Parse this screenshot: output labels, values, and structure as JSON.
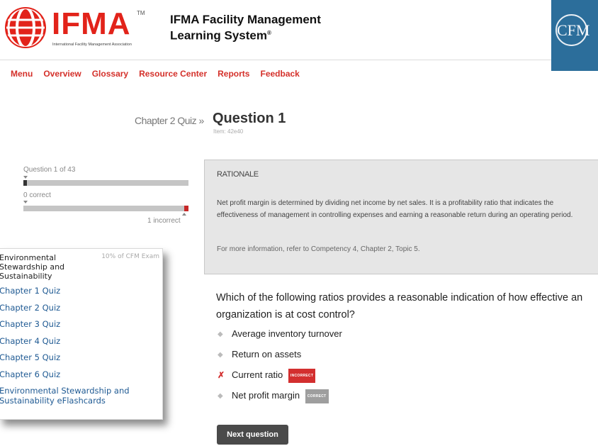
{
  "brand": {
    "logo_text": "IFMA",
    "logo_tm": "TM",
    "logo_subtitle": "International Facility Management Association",
    "title_line1": "IFMA Facility Management",
    "title_line2": "Learning System",
    "title_reg": "®",
    "cfm_logo": "CFM",
    "colors": {
      "red": "#e2231a",
      "cfm_blue": "#2c6e9b"
    }
  },
  "nav": {
    "items": [
      {
        "label": "Menu"
      },
      {
        "label": "Overview"
      },
      {
        "label": "Glossary"
      },
      {
        "label": "Resource Center"
      },
      {
        "label": "Reports"
      },
      {
        "label": "Feedback"
      }
    ]
  },
  "page": {
    "breadcrumb": "Chapter 2 Quiz »",
    "title": "Question 1",
    "item_id": "Item: 42e40"
  },
  "progress": {
    "question_label": "Question 1 of 43",
    "question_fraction": 0.023,
    "correct_label": "0 correct",
    "incorrect_label": "1 incorrect"
  },
  "popup": {
    "topic": "Environmental Stewardship and Sustainability",
    "percent": "10% of CFM Exam",
    "items": [
      {
        "label": "Chapter 1 Quiz"
      },
      {
        "label": "Chapter 2 Quiz"
      },
      {
        "label": "Chapter 3 Quiz"
      },
      {
        "label": "Chapter 4 Quiz"
      },
      {
        "label": "Chapter 5 Quiz"
      },
      {
        "label": "Chapter 6 Quiz"
      },
      {
        "label": "Environmental Stewardship and Sustainability eFlashcards"
      }
    ]
  },
  "rationale": {
    "heading": "RATIONALE",
    "body": "Net profit margin is determined by dividing net income by net sales. It is a profitability ratio that indicates the effectiveness of management in controlling expenses and earning a reasonable return during an operating period.",
    "reference": "For more information, refer to Competency 4, Chapter 2, Topic 5."
  },
  "question": {
    "text": "Which of the following ratios provides a reasonable indication of how effective an organization is at cost control?",
    "answers": [
      {
        "label": "Average inventory turnover",
        "mark": "◆",
        "badge": ""
      },
      {
        "label": "Return on assets",
        "mark": "◆",
        "badge": ""
      },
      {
        "label": "Current ratio",
        "mark": "✗",
        "badge": "INCORRECT"
      },
      {
        "label": "Net profit margin",
        "mark": "◆",
        "badge": "CORRECT"
      }
    ]
  },
  "actions": {
    "next_label": "Next question"
  }
}
